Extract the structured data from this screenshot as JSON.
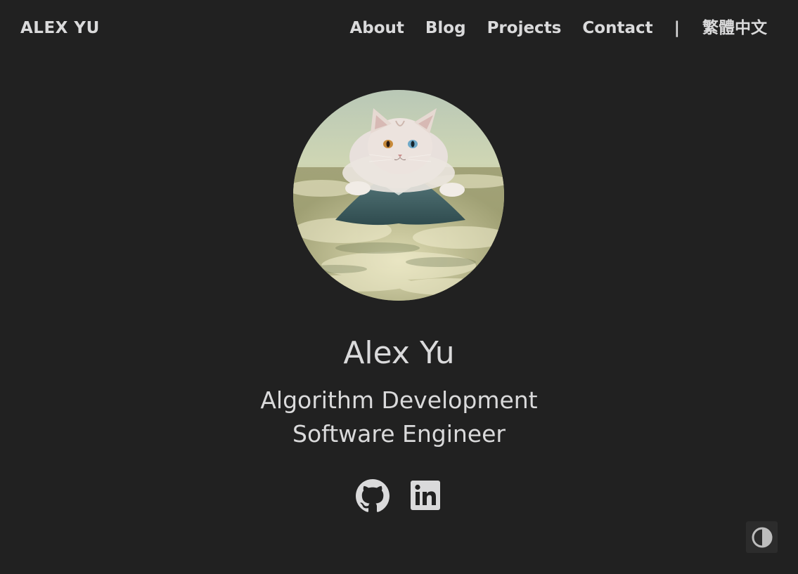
{
  "header": {
    "brand": "ALEX YU",
    "nav": [
      {
        "label": "About"
      },
      {
        "label": "Blog"
      },
      {
        "label": "Projects"
      },
      {
        "label": "Contact"
      }
    ],
    "separator": "|",
    "language": "繁體中文"
  },
  "profile": {
    "avatar_icon": "cat-avatar-image",
    "name": "Alex Yu",
    "subtitle_line1": "Algorithm Development",
    "subtitle_line2": "Software Engineer"
  },
  "social": [
    {
      "icon": "github-icon"
    },
    {
      "icon": "linkedin-icon"
    }
  ],
  "theme_toggle": {
    "icon": "contrast-icon"
  },
  "colors": {
    "background": "#212121",
    "text": "#dadadb",
    "toggle_bg": "#2c2c2c"
  }
}
